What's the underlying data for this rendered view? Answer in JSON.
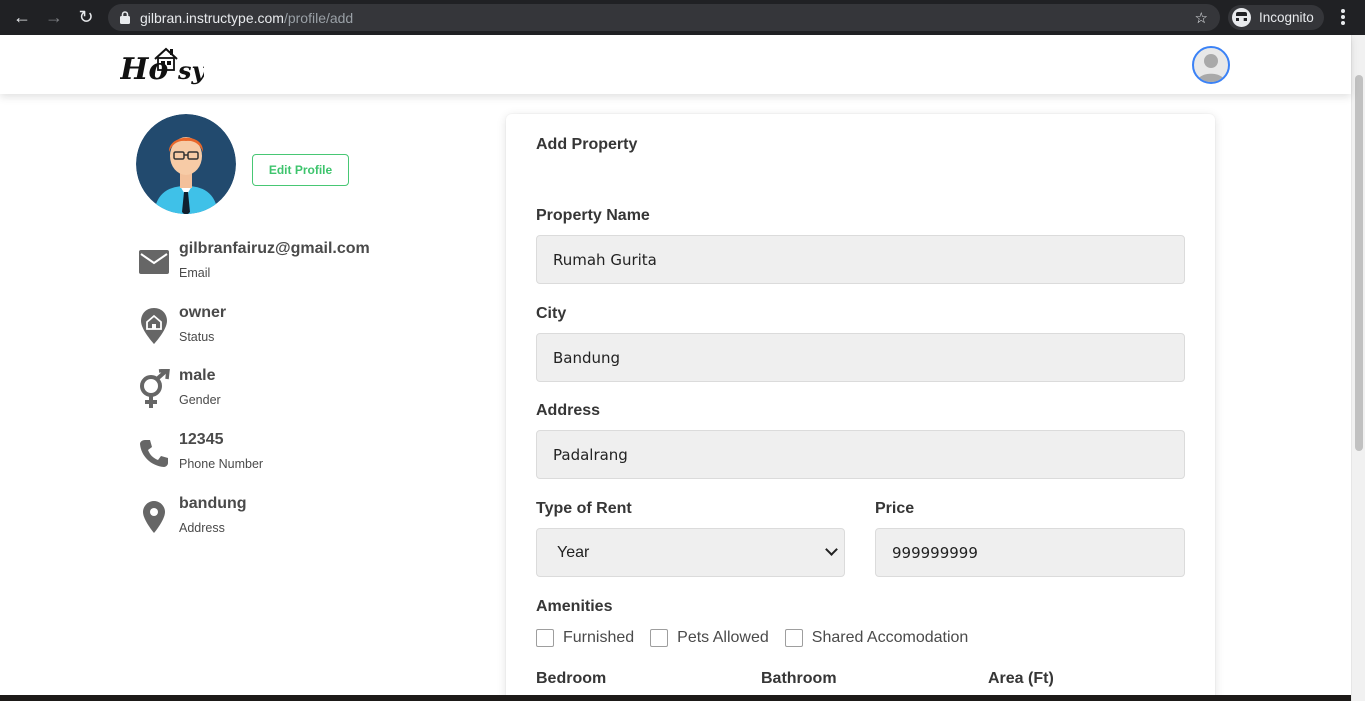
{
  "browser": {
    "back_icon": "←",
    "forward_icon": "→",
    "reload_icon": "↻",
    "lock_icon": "lock-icon",
    "url_domain": "gilbran.instructype.com",
    "url_path": "/profile/add",
    "star_icon": "☆",
    "incognito_label": "Incognito"
  },
  "navbar": {
    "logo_text": "Hosy"
  },
  "profile": {
    "edit_button": "Edit Profile",
    "items": [
      {
        "value": "gilbranfairuz@gmail.com",
        "label": "Email",
        "icon": "email-icon"
      },
      {
        "value": "owner",
        "label": "Status",
        "icon": "home-pin-icon"
      },
      {
        "value": "male",
        "label": "Gender",
        "icon": "gender-icon"
      },
      {
        "value": "12345",
        "label": "Phone Number",
        "icon": "phone-icon"
      },
      {
        "value": "bandung",
        "label": "Address",
        "icon": "location-pin-icon"
      }
    ]
  },
  "form": {
    "title": "Add Property",
    "property_name": {
      "label": "Property Name",
      "value": "Rumah Gurita"
    },
    "city": {
      "label": "City",
      "value": "Bandung"
    },
    "address": {
      "label": "Address",
      "value": "Padalrang"
    },
    "type_of_rent": {
      "label": "Type of Rent",
      "value": "Year"
    },
    "price": {
      "label": "Price",
      "value": "999999999"
    },
    "amenities": {
      "label": "Amenities",
      "options": [
        {
          "label": "Furnished",
          "checked": false
        },
        {
          "label": "Pets Allowed",
          "checked": false
        },
        {
          "label": "Shared Accomodation",
          "checked": false
        }
      ]
    },
    "bedroom_label": "Bedroom",
    "bathroom_label": "Bathroom",
    "area_label": "Area (Ft)"
  },
  "colors": {
    "accent_green": "#48c774",
    "chrome_bg": "#202124",
    "input_bg": "#efefef"
  }
}
